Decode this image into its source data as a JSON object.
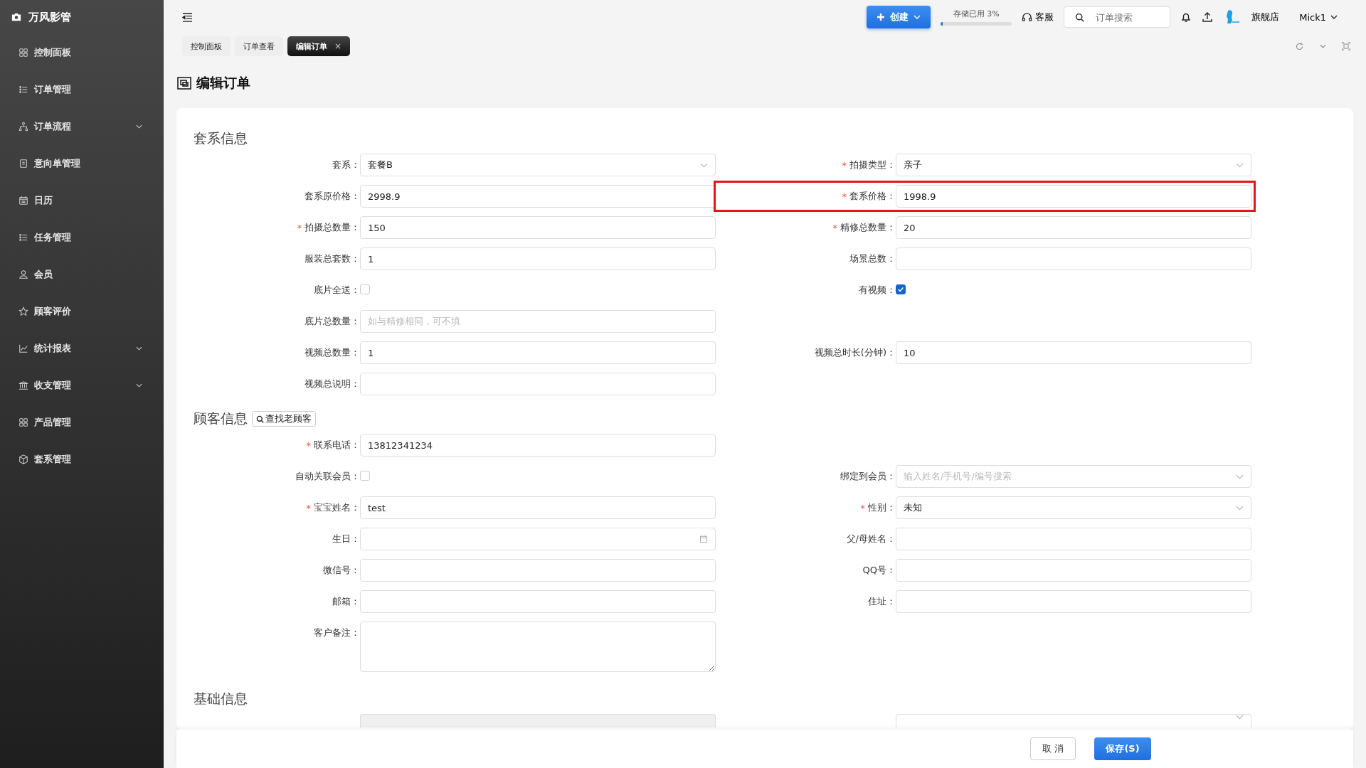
{
  "brand": {
    "name": "万风影管"
  },
  "sidebar": {
    "items": [
      {
        "label": "控制面板",
        "kind": "link"
      },
      {
        "label": "订单管理",
        "kind": "link"
      },
      {
        "label": "订单流程",
        "kind": "group"
      },
      {
        "label": "意向单管理",
        "kind": "link"
      },
      {
        "label": "日历",
        "kind": "link"
      },
      {
        "label": "任务管理",
        "kind": "link"
      },
      {
        "label": "会员",
        "kind": "link"
      },
      {
        "label": "顾客评价",
        "kind": "link"
      },
      {
        "label": "统计报表",
        "kind": "group"
      },
      {
        "label": "收支管理",
        "kind": "group"
      },
      {
        "label": "产品管理",
        "kind": "link"
      },
      {
        "label": "套系管理",
        "kind": "link"
      }
    ]
  },
  "header": {
    "create_button": "创建",
    "storage": {
      "label": "存储已用 3%",
      "level": 0.03
    },
    "service": "客服",
    "search": {
      "placeholder": "订单搜索"
    },
    "store": "旗舰店",
    "user": "Mick1"
  },
  "tabs": [
    {
      "label": "控制面板",
      "selected": false
    },
    {
      "label": "订单查看",
      "selected": false
    },
    {
      "label": "编辑订单",
      "selected": true,
      "close": "×"
    }
  ],
  "page_title": "编辑订单",
  "sections": [
    {
      "title": "套系信息",
      "rows": [
        [
          {
            "kind": "select",
            "label": "套系：",
            "value": "套餐B"
          },
          {
            "kind": "select",
            "required_mark": "*",
            "label": "拍摄类型：",
            "value": "亲子"
          }
        ],
        [
          {
            "kind": "input",
            "label": "套系原价格：",
            "value": "2998.9"
          },
          {
            "kind": "input",
            "required_mark": "*",
            "label": "套系价格：",
            "value": "1998.9",
            "highlighted": true
          }
        ],
        [
          {
            "kind": "input",
            "required_mark": "*",
            "label": "拍摄总数量：",
            "value": "150"
          },
          {
            "kind": "input",
            "required_mark": "*",
            "label": "精修总数量：",
            "value": "20"
          }
        ],
        [
          {
            "kind": "input",
            "label": "服装总套数：",
            "value": "1"
          },
          {
            "kind": "input",
            "label": "场景总数："
          }
        ],
        [
          {
            "kind": "checkbox",
            "label": "底片全送：",
            "checked": false
          },
          {
            "kind": "checkbox",
            "label": "有视频：",
            "checked": true
          }
        ],
        [
          {
            "kind": "input",
            "label": "底片总数量：",
            "placeholder": "如与精修相同，可不填"
          }
        ],
        [
          {
            "kind": "input",
            "label": "视频总数量：",
            "value": "1"
          },
          {
            "kind": "input",
            "label": "视频总时长(分钟)：",
            "value": "10"
          }
        ],
        [
          {
            "kind": "input",
            "label": "视频总说明："
          }
        ]
      ]
    },
    {
      "title": "顾客信息",
      "button": "查找老顾客",
      "rows": [
        [
          {
            "kind": "input",
            "required_mark": "*",
            "label": "联系电话：",
            "value": "13812341234"
          }
        ],
        [
          {
            "kind": "checkbox",
            "label": "自动关联会员：",
            "checked": false
          },
          {
            "kind": "select",
            "label": "绑定到会员：",
            "placeholder": "输入姓名/手机号/编号搜索"
          }
        ],
        [
          {
            "kind": "input",
            "required_mark": "*",
            "label": "宝宝姓名：",
            "value": "test"
          },
          {
            "kind": "select",
            "required_mark": "*",
            "label": "性别：",
            "value": "未知"
          }
        ],
        [
          {
            "kind": "date",
            "label": "生日："
          },
          {
            "kind": "input",
            "label": "父/母姓名："
          }
        ],
        [
          {
            "kind": "input",
            "label": "微信号："
          },
          {
            "kind": "input",
            "label": "QQ号："
          }
        ],
        [
          {
            "kind": "input",
            "label": "邮箱："
          },
          {
            "kind": "input",
            "label": "住址："
          }
        ],
        [
          {
            "kind": "textarea",
            "label": "客户备注："
          }
        ]
      ]
    },
    {
      "title": "基础信息",
      "rows": [
        [
          {
            "kind": "input",
            "disabled": true
          },
          {
            "kind": "select"
          }
        ]
      ]
    }
  ],
  "footer": {
    "cancel": "取 消",
    "save": "保存(S)"
  }
}
